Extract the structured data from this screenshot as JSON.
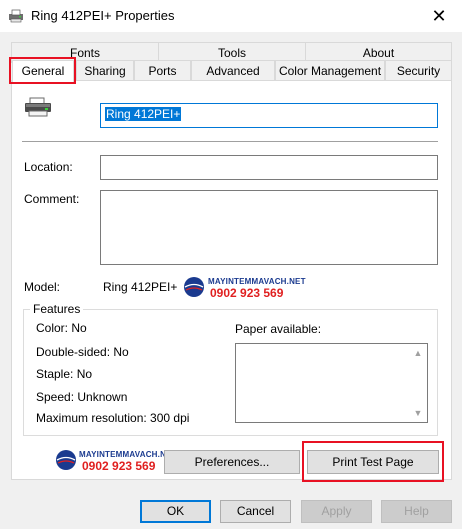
{
  "window": {
    "title": "Ring 412PEI+ Properties",
    "close_glyph": "✕"
  },
  "tabs": {
    "row1": [
      "Fonts",
      "Tools",
      "About"
    ],
    "row2": [
      "General",
      "Sharing",
      "Ports",
      "Advanced",
      "Color Management",
      "Security"
    ],
    "active": "General"
  },
  "general": {
    "printer_icon": "printer-icon",
    "name_value": "Ring 412PEI+",
    "location_label": "Location:",
    "location_value": "",
    "comment_label": "Comment:",
    "comment_value": "",
    "model_label": "Model:",
    "model_value": "Ring 412PEI+"
  },
  "watermark": {
    "url": "MAYINTEMMAVACH.NET",
    "phone": "0902 923 569"
  },
  "features": {
    "title": "Features",
    "color": "Color: No",
    "double_sided": "Double-sided: No",
    "staple": "Staple: No",
    "speed": "Speed: Unknown",
    "max_resolution": "Maximum resolution: 300 dpi",
    "paper_label": "Paper available:",
    "paper_items": []
  },
  "buttons": {
    "preferences": "Preferences...",
    "print_test_page": "Print Test Page",
    "ok": "OK",
    "cancel": "Cancel",
    "apply": "Apply",
    "help": "Help"
  },
  "highlight_color": "#e81123",
  "accent_color": "#0078d7"
}
